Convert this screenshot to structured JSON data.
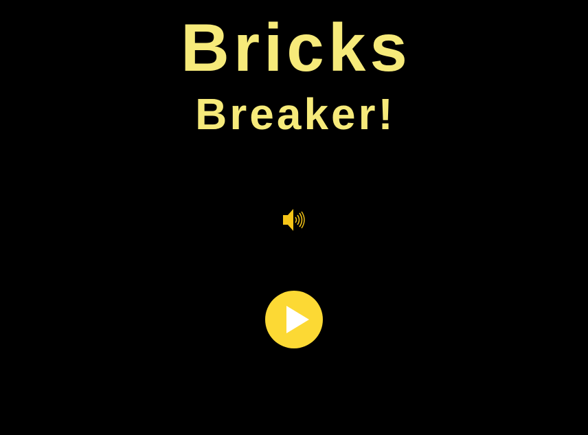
{
  "game": {
    "title_line1": "Bricks",
    "title_line2": "Breaker!"
  },
  "controls": {
    "sound_icon": "speaker-volume-icon",
    "sound_state": "on",
    "play_icon": "play-icon"
  },
  "colors": {
    "background": "#000000",
    "title": "#f6ea7a",
    "accent": "#fcd934",
    "play_glyph": "#ffffff"
  }
}
